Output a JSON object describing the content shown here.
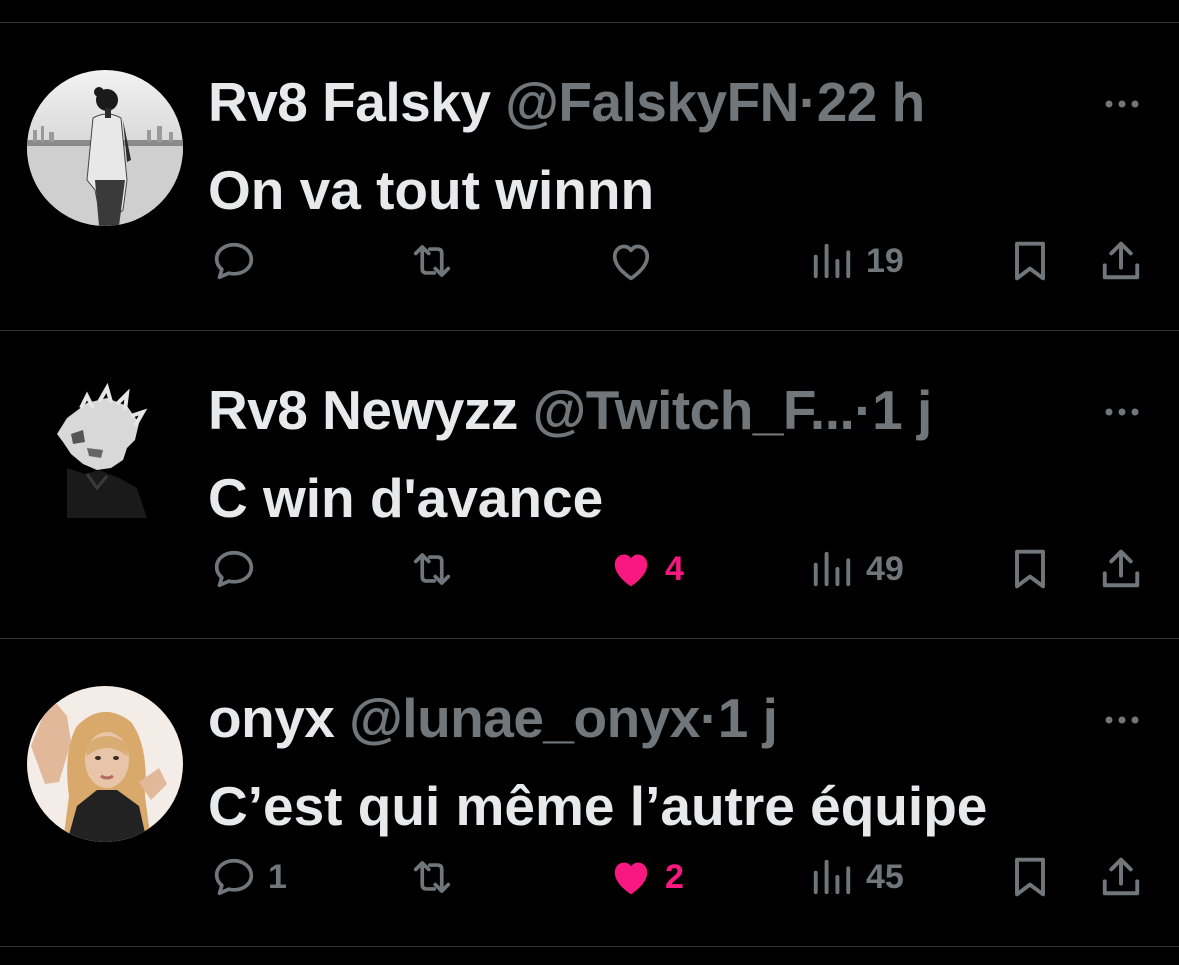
{
  "tweets": [
    {
      "name": "Rv8 Falsky",
      "handle": "@FalskyFN",
      "separator": "·",
      "time": "22 h",
      "text": "On va tout winnn",
      "avatar_icon": "avatar-man-by-sea",
      "reply_count": "",
      "like_count": "",
      "liked": false,
      "views": "19"
    },
    {
      "name": "Rv8 Newyzz",
      "handle": "@Twitch_F...",
      "separator": "·",
      "time": "1 j",
      "text": "C win d'avance",
      "avatar_icon": "avatar-manga-character",
      "reply_count": "",
      "like_count": "4",
      "liked": true,
      "views": "49"
    },
    {
      "name": "onyx",
      "handle": "@lunae_onyx",
      "separator": "·",
      "time": "1 j",
      "text": "C’est qui même l’autre équipe",
      "avatar_icon": "avatar-woman-blonde",
      "reply_count": "1",
      "like_count": "2",
      "liked": true,
      "views": "45"
    }
  ],
  "colors": {
    "background": "#000000",
    "text_primary": "#e7e9ea",
    "text_secondary": "#71767b",
    "like_active": "#f91880",
    "divider": "#2f3336"
  },
  "icons": [
    "reply-icon",
    "retweet-icon",
    "like-icon",
    "views-icon",
    "bookmark-icon",
    "share-icon",
    "more-icon"
  ]
}
